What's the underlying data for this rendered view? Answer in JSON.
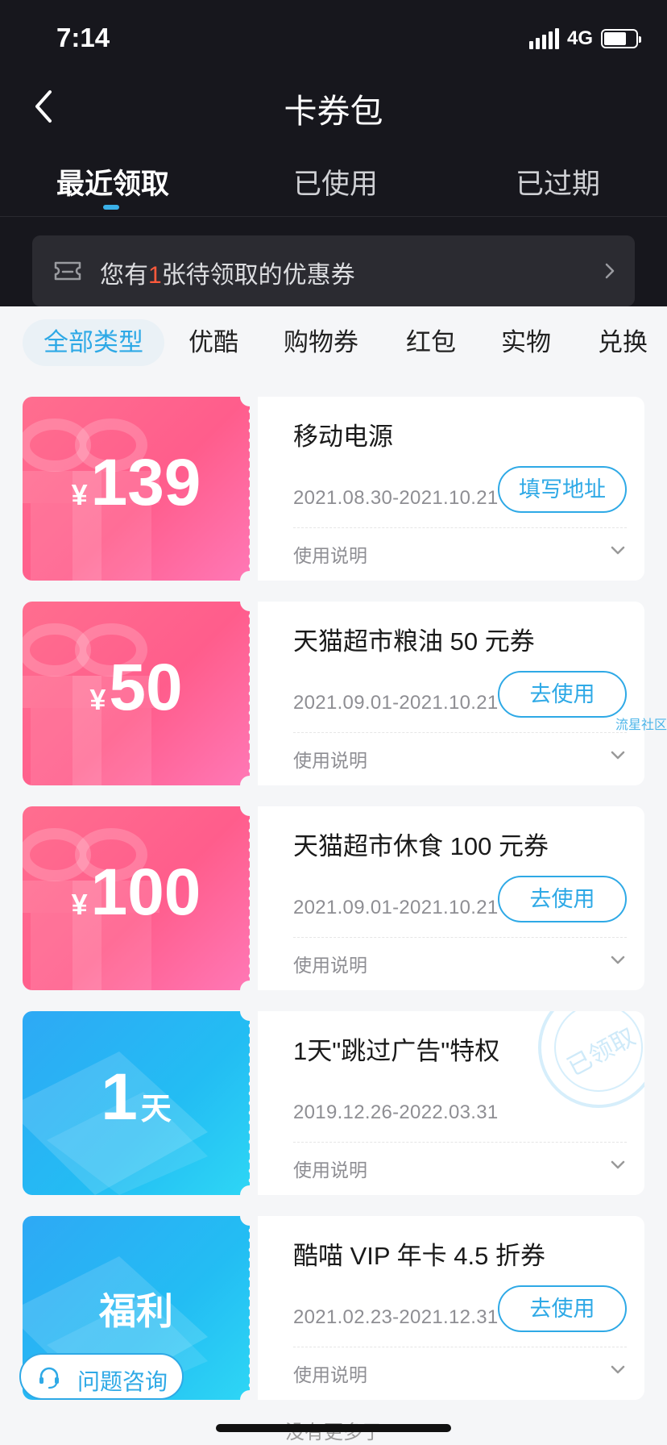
{
  "status_bar": {
    "time": "7:14",
    "network": "4G"
  },
  "header": {
    "title": "卡券包"
  },
  "tabs": [
    {
      "label": "最近领取",
      "active": true
    },
    {
      "label": "已使用",
      "active": false
    },
    {
      "label": "已过期",
      "active": false
    }
  ],
  "notice": {
    "prefix": "您有",
    "count": "1",
    "suffix": "张待领取的优惠券"
  },
  "filters": [
    {
      "label": "全部类型",
      "active": true
    },
    {
      "label": "优酷"
    },
    {
      "label": "购物券"
    },
    {
      "label": "红包"
    },
    {
      "label": "实物"
    },
    {
      "label": "兑换"
    }
  ],
  "cards": [
    {
      "theme": "pink",
      "currency": "¥",
      "amount": "139",
      "unit": "",
      "title": "移动电源",
      "date": "2021.08.30-2021.10.21",
      "button": "填写地址",
      "desc": "使用说明"
    },
    {
      "theme": "pink",
      "currency": "¥",
      "amount": "50",
      "unit": "",
      "title": "天猫超市粮油 50 元券",
      "date": "2021.09.01-2021.10.21",
      "button": "去使用",
      "desc": "使用说明"
    },
    {
      "theme": "pink",
      "currency": "¥",
      "amount": "100",
      "unit": "",
      "title": "天猫超市休食 100 元券",
      "date": "2021.09.01-2021.10.21",
      "button": "去使用",
      "desc": "使用说明"
    },
    {
      "theme": "blue",
      "currency": "",
      "amount": "1",
      "unit": "天",
      "title": "1天\"跳过广告\"特权",
      "date": "2019.12.26-2022.03.31",
      "button": "",
      "stamp": "已领取",
      "desc": "使用说明"
    },
    {
      "theme": "blue",
      "currency": "",
      "amount": "",
      "unit": "",
      "label": "福利",
      "title": "酷喵 VIP 年卡 4.5 折券",
      "date": "2021.02.23-2021.12.31",
      "button": "去使用",
      "desc": "使用说明"
    }
  ],
  "watermark": "流星社区",
  "float_button": {
    "label": "问题咨询"
  },
  "footer": {
    "no_more": "没有更多了"
  },
  "colors": {
    "accent": "#2ea9e6",
    "header_bg": "#17171d",
    "highlight": "#ff5a3c"
  }
}
